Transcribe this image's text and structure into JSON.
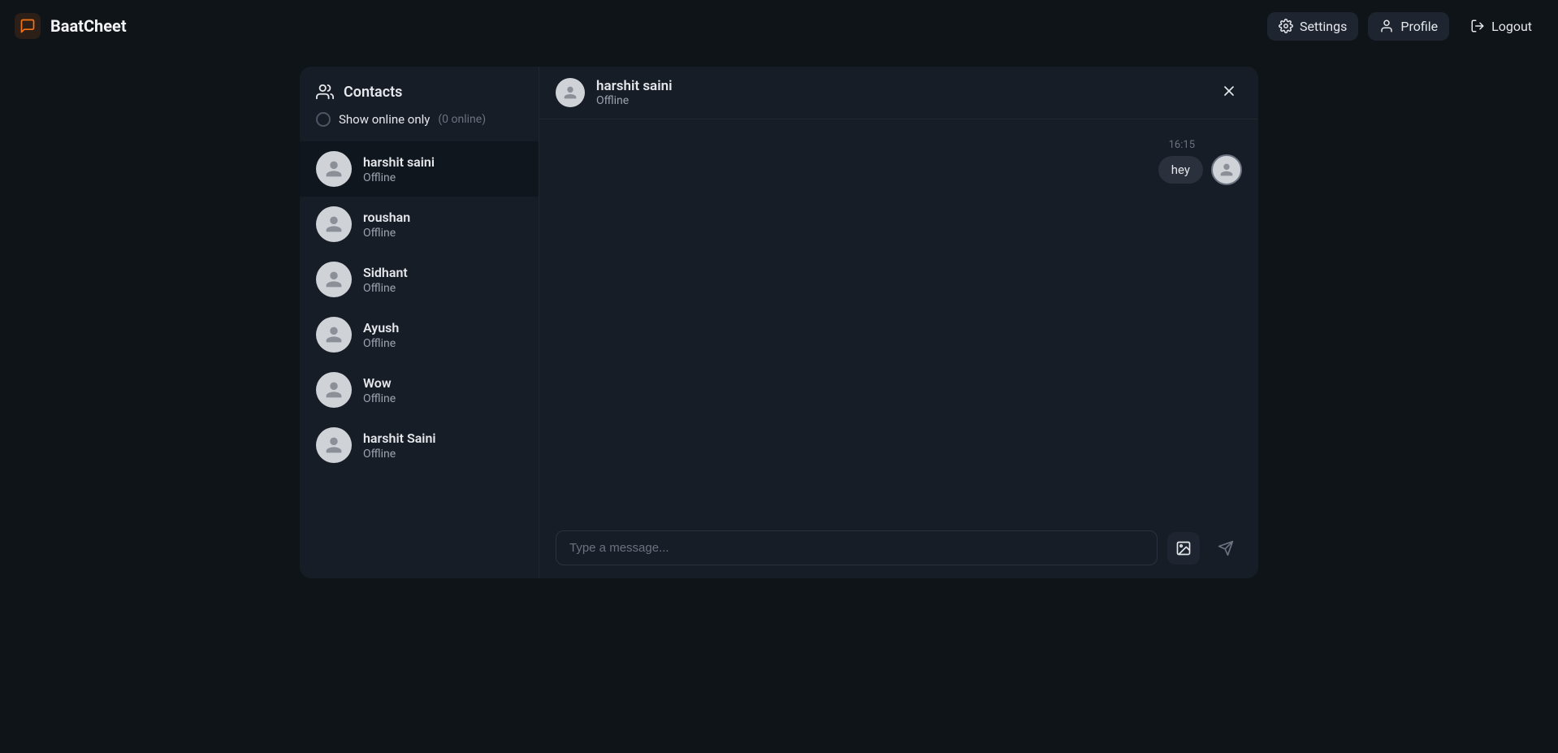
{
  "brand": {
    "name": "BaatCheet"
  },
  "topbar": {
    "settings": "Settings",
    "profile": "Profile",
    "logout": "Logout"
  },
  "sidebar": {
    "title": "Contacts",
    "filter_label": "Show online only",
    "online_count": "(0 online)",
    "contacts": [
      {
        "name": "harshit saini",
        "status": "Offline",
        "selected": true
      },
      {
        "name": "roushan",
        "status": "Offline",
        "selected": false
      },
      {
        "name": "Sidhant",
        "status": "Offline",
        "selected": false
      },
      {
        "name": "Ayush",
        "status": "Offline",
        "selected": false
      },
      {
        "name": "Wow",
        "status": "Offline",
        "selected": false
      },
      {
        "name": "harshit Saini",
        "status": "Offline",
        "selected": false
      }
    ]
  },
  "chat": {
    "header": {
      "name": "harshit saini",
      "status": "Offline"
    },
    "messages": [
      {
        "time": "16:15",
        "text": "hey",
        "mine": true
      }
    ],
    "composer": {
      "placeholder": "Type a message..."
    }
  }
}
